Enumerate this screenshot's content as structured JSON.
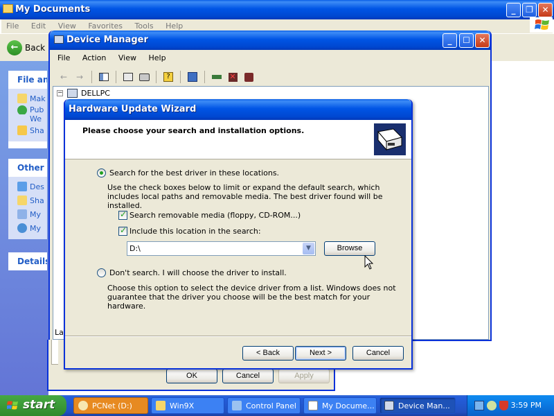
{
  "my_documents": {
    "title": "My Documents",
    "menu": [
      "File",
      "Edit",
      "View",
      "Favorites",
      "Tools",
      "Help"
    ],
    "back_label": "Back",
    "task_pane": {
      "file_and_folder": {
        "header": "File and",
        "items": [
          "Mak",
          "Pub",
          "We",
          "Sha"
        ]
      },
      "other_places": {
        "header": "Other P",
        "items": [
          "Des",
          "Sha",
          "My",
          "My"
        ]
      },
      "details": {
        "header": "Details"
      }
    }
  },
  "device_manager": {
    "title": "Device Manager",
    "menu": [
      "File",
      "Action",
      "View",
      "Help"
    ],
    "tree_root": "DELLPC",
    "status_fragment": "Lau"
  },
  "properties_dialog": {
    "ok_label": "OK",
    "cancel_label": "Cancel",
    "apply_label": "Apply"
  },
  "wizard": {
    "title": "Hardware Update Wizard",
    "header": "Please choose your search and installation options.",
    "option_search": {
      "label": "Search for the best driver in these locations.",
      "description": "Use the check boxes below to limit or expand the default search, which includes local paths and removable media. The best driver found will be installed.",
      "selected": true
    },
    "check_removable": {
      "label": "Search removable media (floppy, CD-ROM...)",
      "checked": true
    },
    "check_location": {
      "label": "Include this location in the search:",
      "checked": true
    },
    "location_value": "D:\\",
    "browse_label": "Browse",
    "option_dont_search": {
      "label": "Don't search. I will choose the driver to install.",
      "description": "Choose this option to select the device driver from a list.  Windows does not guarantee that the driver you choose will be the best match for your hardware.",
      "selected": false
    },
    "back_label": "< Back",
    "next_label": "Next >",
    "cancel_label": "Cancel"
  },
  "taskbar": {
    "start_label": "start",
    "tasks": [
      {
        "label": "PCNet (D:)"
      },
      {
        "label": "Win9X"
      },
      {
        "label": "Control Panel"
      },
      {
        "label": "My Docume..."
      },
      {
        "label": "Device Man..."
      }
    ],
    "clock": "3:59 PM"
  }
}
